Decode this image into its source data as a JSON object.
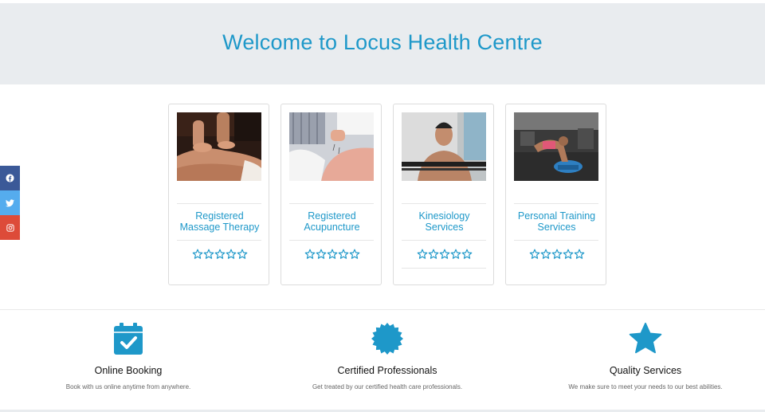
{
  "hero": {
    "title": "Welcome to Locus Health Centre"
  },
  "social": [
    {
      "name": "facebook",
      "color": "#3b5998"
    },
    {
      "name": "twitter",
      "color": "#55acee"
    },
    {
      "name": "instagram",
      "color": "#dd4b39"
    }
  ],
  "services": [
    {
      "title_line1": "Registered",
      "title_line2": "Massage Therapy",
      "rating": 0,
      "max": 5
    },
    {
      "title_line1": "Registered",
      "title_line2": "Acupuncture",
      "rating": 0,
      "max": 5
    },
    {
      "title_line1": "Kinesiology",
      "title_line2": "Services",
      "rating": 0,
      "max": 5
    },
    {
      "title_line1": "Personal Training",
      "title_line2": "Services",
      "rating": 0,
      "max": 5
    }
  ],
  "features": [
    {
      "icon": "calendar-check-icon",
      "title": "Online Booking",
      "desc": "Book with us online anytime from anywhere."
    },
    {
      "icon": "certificate-icon",
      "title": "Certified Professionals",
      "desc": "Get treated by our certified health care professionals."
    },
    {
      "icon": "star-icon",
      "title": "Quality Services",
      "desc": "We make sure to meet your needs to our best abilities."
    }
  ],
  "colors": {
    "accent": "#1e98c9",
    "hero_bg": "#e9ecef"
  }
}
